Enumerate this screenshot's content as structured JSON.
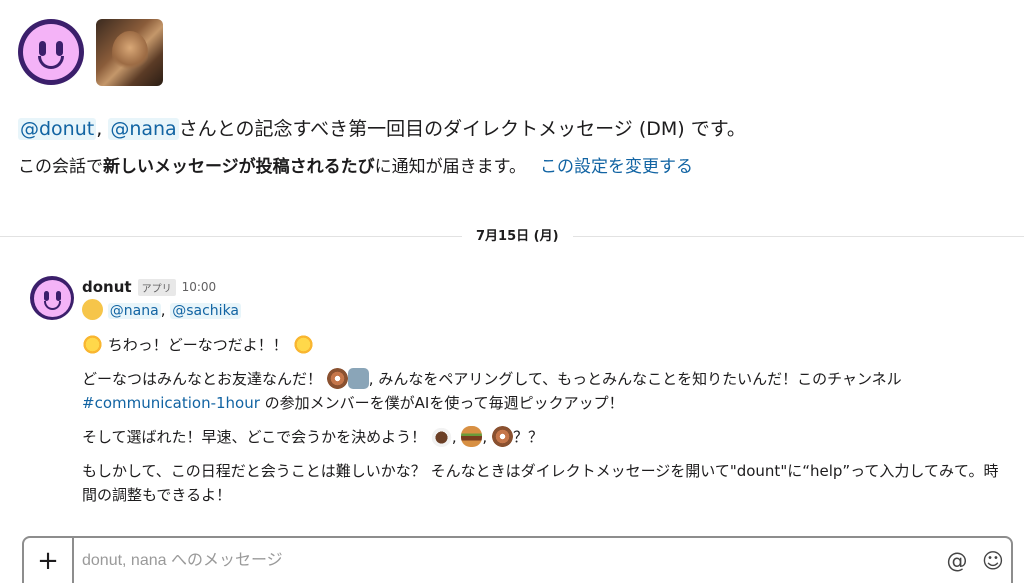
{
  "intro": {
    "mention_1": "@donut",
    "separator": ", ",
    "mention_2": "@nana",
    "text": "さんとの記念すべき第一回目のダイレクトメッセージ (DM) です。"
  },
  "subline": {
    "prefix": "この会話で",
    "bold": "新しいメッセージが投稿されるたび",
    "suffix": "に通知が届きます。",
    "link": "この設定を変更する"
  },
  "date_divider": "7月15日 (月)",
  "message": {
    "sender": "donut",
    "badge": "アプリ",
    "time": "10:00",
    "mention_1": "@nana",
    "mention_sep": ", ",
    "mention_2": "@sachika",
    "line_1": " ちわっ！どーなつだよ！！ ",
    "line_2_a": "どーなつはみんなとお友達なんだ！ ",
    "line_2_b": ", みんなをペアリングして、もっとみんなことを知りたいんだ！このチャンネル",
    "channel": "#communication-1hour",
    "line_2_c": " の参加メンバーを僕がAIを使って毎週ピックアップ！",
    "line_3_a": "そして選ばれた！早速、どこで会うかを決めよう！ ",
    "line_3_sep": ", ",
    "line_3_end": "？？",
    "line_4": "もしかして、この日程だと会うことは難しいかな？ そんなときはダイレクトメッセージを開いて\"dount\"に“help”って入力してみて。時間の調整もできるよ！"
  },
  "composer": {
    "placeholder": "donut, nana へのメッセージ",
    "plus_label": "+",
    "at_label": "@",
    "emoji_label": "☺"
  },
  "icons": [
    "donut-bot-avatar",
    "user-photo-avatar",
    "wave-emoji",
    "sun-emoji",
    "donut-emoji",
    "robot-emoji",
    "coffee-emoji",
    "burger-emoji",
    "plus-icon",
    "at-icon",
    "emoji-icon"
  ],
  "colors": {
    "link": "#1264a3",
    "mention_bg": "#e8f5fa",
    "avatar_dark": "#3b1f6b",
    "avatar_face": "#f4b3f7"
  }
}
